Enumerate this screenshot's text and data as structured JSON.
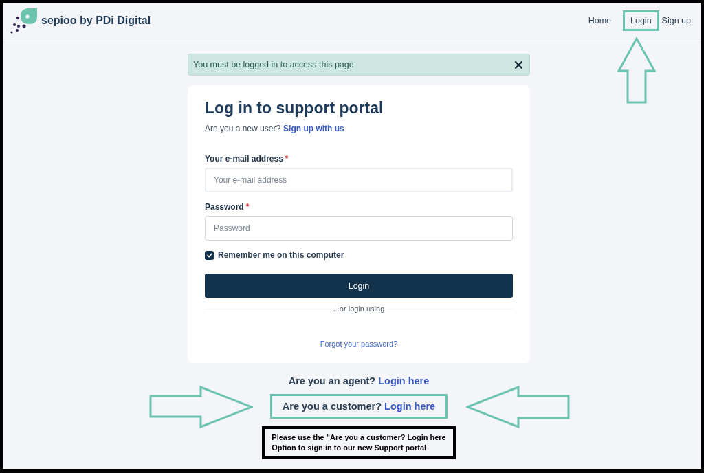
{
  "header": {
    "brand": "sepioo by PDi Digital",
    "nav": [
      {
        "label": "Home",
        "annotated": false
      },
      {
        "label": "Login",
        "annotated": true
      },
      {
        "label": "Sign up",
        "annotated": false
      }
    ]
  },
  "alert": {
    "message": "You must be logged in to access this page"
  },
  "login_card": {
    "title": "Log in to support portal",
    "signup_prompt": "Are you a new user?",
    "signup_link": "Sign up with us",
    "fields": [
      {
        "label": "Your e-mail address",
        "required_mark": "*",
        "placeholder": "Your e-mail address"
      },
      {
        "label": "Password",
        "required_mark": "*",
        "placeholder": "Password"
      }
    ],
    "remember": {
      "label": "Remember me on this computer",
      "checked": true
    },
    "submit_button": "Login",
    "divider": "...or login using",
    "forgot_link": "Forgot your password?"
  },
  "alternate_logins": [
    {
      "prompt": "Are you an agent?",
      "link": "Login here",
      "annotated": false
    },
    {
      "prompt": "Are you a customer?",
      "link": "Login here",
      "annotated": true
    }
  ],
  "note": {
    "lines": [
      "Please use the \"Are you a customer? Login here",
      "Option to sign in to our new Support portal"
    ]
  }
}
